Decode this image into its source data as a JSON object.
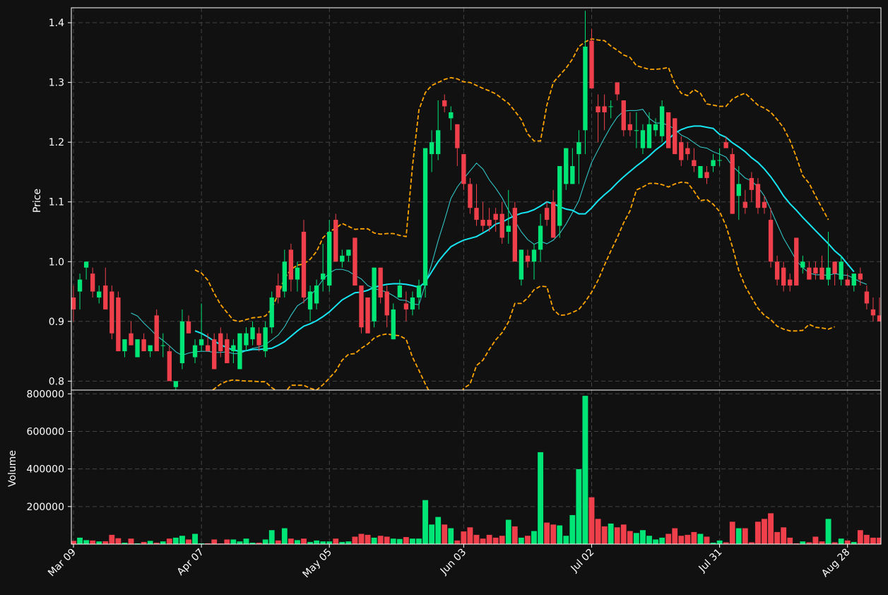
{
  "chart_data": {
    "type": "candlestick",
    "colors": {
      "background": "#111111",
      "up": "#00e676",
      "down": "#ef3f4b",
      "ma_short": "#34d3d3",
      "ma_long": "#17e6f2",
      "bollinger": "#ffa500",
      "grid": "#444444",
      "axes": "#ffffff"
    },
    "price_panel": {
      "ylabel": "Price",
      "ylim": [
        0.785,
        1.425
      ],
      "yticks": [
        0.8,
        0.9,
        1.0,
        1.1,
        1.2,
        1.3,
        1.4
      ],
      "ytick_labels": [
        "0.8",
        "0.9",
        "1.0",
        "1.1",
        "1.2",
        "1.3",
        "1.4"
      ],
      "grid": true
    },
    "volume_panel": {
      "ylabel": "Volume",
      "ylim": [
        0,
        820000
      ],
      "yticks": [
        200000,
        400000,
        600000,
        800000
      ],
      "ytick_labels": [
        "200000",
        "400000",
        "600000",
        "800000"
      ],
      "grid": true
    },
    "x_ticks": [
      {
        "label": "Mar 09",
        "index": 0
      },
      {
        "label": "Apr 07",
        "index": 20
      },
      {
        "label": "May 05",
        "index": 40
      },
      {
        "label": "Jun 03",
        "index": 61
      },
      {
        "label": "Jul 02",
        "index": 81
      },
      {
        "label": "Jul 31",
        "index": 101
      },
      {
        "label": "Aug 28",
        "index": 121
      }
    ],
    "candles": [
      [
        0.94,
        0.96,
        0.9,
        0.92,
        18000
      ],
      [
        0.95,
        0.98,
        0.92,
        0.97,
        35000
      ],
      [
        0.99,
        1.0,
        0.97,
        1.0,
        22000
      ],
      [
        0.98,
        0.99,
        0.94,
        0.95,
        20000
      ],
      [
        0.94,
        0.96,
        0.93,
        0.95,
        15000
      ],
      [
        0.96,
        0.99,
        0.92,
        0.92,
        16000
      ],
      [
        0.95,
        0.96,
        0.87,
        0.88,
        50000
      ],
      [
        0.94,
        0.95,
        0.85,
        0.85,
        32000
      ],
      [
        0.85,
        0.87,
        0.84,
        0.87,
        8000
      ],
      [
        0.88,
        0.9,
        0.86,
        0.86,
        30000
      ],
      [
        0.84,
        0.87,
        0.84,
        0.87,
        5000
      ],
      [
        0.87,
        0.88,
        0.85,
        0.85,
        12000
      ],
      [
        0.85,
        0.86,
        0.84,
        0.86,
        18000
      ],
      [
        0.91,
        0.92,
        0.85,
        0.85,
        8000
      ],
      [
        0.86,
        0.88,
        0.84,
        0.86,
        15000
      ],
      [
        0.85,
        0.86,
        0.8,
        0.8,
        30000
      ],
      [
        0.79,
        0.8,
        0.78,
        0.8,
        35000
      ],
      [
        0.83,
        0.92,
        0.82,
        0.9,
        45000
      ],
      [
        0.9,
        0.91,
        0.88,
        0.88,
        25000
      ],
      [
        0.84,
        0.87,
        0.83,
        0.86,
        55000
      ],
      [
        0.86,
        0.93,
        0.85,
        0.87,
        5000
      ],
      [
        0.86,
        0.88,
        0.85,
        0.85,
        5000
      ],
      [
        0.87,
        0.88,
        0.82,
        0.82,
        25000
      ],
      [
        0.88,
        0.89,
        0.84,
        0.85,
        4000
      ],
      [
        0.87,
        0.88,
        0.83,
        0.83,
        25000
      ],
      [
        0.85,
        0.87,
        0.83,
        0.86,
        25000
      ],
      [
        0.82,
        0.87,
        0.82,
        0.88,
        15000
      ],
      [
        0.86,
        0.89,
        0.85,
        0.88,
        30000
      ],
      [
        0.87,
        0.9,
        0.86,
        0.89,
        8000
      ],
      [
        0.88,
        0.89,
        0.85,
        0.86,
        8000
      ],
      [
        0.85,
        0.9,
        0.84,
        0.89,
        25000
      ],
      [
        0.89,
        0.95,
        0.88,
        0.94,
        75000
      ],
      [
        0.96,
        0.98,
        0.93,
        0.94,
        20000
      ],
      [
        0.95,
        1.02,
        0.94,
        1.0,
        85000
      ],
      [
        1.02,
        1.03,
        0.95,
        0.97,
        30000
      ],
      [
        0.97,
        1.0,
        0.95,
        0.99,
        22000
      ],
      [
        1.05,
        1.07,
        0.93,
        0.94,
        30000
      ],
      [
        0.92,
        0.96,
        0.9,
        0.95,
        12000
      ],
      [
        0.93,
        0.97,
        0.92,
        0.96,
        20000
      ],
      [
        0.97,
        1.03,
        0.95,
        0.98,
        15000
      ],
      [
        0.96,
        1.07,
        0.95,
        1.05,
        15000
      ],
      [
        1.07,
        1.08,
        1.0,
        1.0,
        30000
      ],
      [
        1.0,
        1.02,
        0.99,
        1.01,
        12000
      ],
      [
        1.01,
        1.02,
        1.0,
        1.02,
        15000
      ],
      [
        1.04,
        1.04,
        0.96,
        0.96,
        40000
      ],
      [
        0.96,
        0.96,
        0.88,
        0.89,
        55000
      ],
      [
        0.94,
        0.94,
        0.88,
        0.88,
        50000
      ],
      [
        0.9,
        0.99,
        0.89,
        0.99,
        35000
      ],
      [
        0.99,
        0.99,
        0.93,
        0.94,
        45000
      ],
      [
        0.95,
        0.96,
        0.89,
        0.91,
        40000
      ],
      [
        0.87,
        0.93,
        0.87,
        0.92,
        30000
      ],
      [
        0.94,
        0.97,
        0.94,
        0.96,
        28000
      ],
      [
        0.93,
        0.95,
        0.9,
        0.92,
        38000
      ],
      [
        0.92,
        0.95,
        0.91,
        0.94,
        30000
      ],
      [
        0.94,
        0.97,
        0.92,
        0.96,
        30000
      ],
      [
        0.96,
        1.19,
        0.94,
        1.19,
        235000
      ],
      [
        1.18,
        1.22,
        1.15,
        1.2,
        105000
      ],
      [
        1.18,
        1.27,
        1.17,
        1.22,
        145000
      ],
      [
        1.27,
        1.28,
        1.25,
        1.26,
        105000
      ],
      [
        1.24,
        1.26,
        1.22,
        1.25,
        85000
      ],
      [
        1.23,
        1.23,
        1.16,
        1.19,
        20000
      ],
      [
        1.18,
        1.18,
        1.12,
        1.13,
        68000
      ],
      [
        1.13,
        1.14,
        1.08,
        1.09,
        90000
      ],
      [
        1.09,
        1.13,
        1.06,
        1.07,
        50000
      ],
      [
        1.07,
        1.1,
        1.05,
        1.06,
        30000
      ],
      [
        1.07,
        1.09,
        1.05,
        1.06,
        50000
      ],
      [
        1.08,
        1.09,
        1.05,
        1.07,
        35000
      ],
      [
        1.08,
        1.1,
        1.03,
        1.04,
        45000
      ],
      [
        1.05,
        1.12,
        1.03,
        1.06,
        130000
      ],
      [
        1.09,
        1.1,
        1.0,
        1.0,
        95000
      ],
      [
        0.97,
        1.02,
        0.96,
        1.02,
        35000
      ],
      [
        1.01,
        1.02,
        0.99,
        1.0,
        45000
      ],
      [
        1.0,
        1.03,
        0.97,
        1.02,
        70000
      ],
      [
        1.02,
        1.08,
        1.0,
        1.06,
        490000
      ],
      [
        1.09,
        1.1,
        1.06,
        1.07,
        115000
      ],
      [
        1.1,
        1.12,
        1.05,
        1.04,
        105000
      ],
      [
        1.06,
        1.16,
        1.04,
        1.16,
        100000
      ],
      [
        1.13,
        1.19,
        1.12,
        1.19,
        45000
      ],
      [
        1.13,
        1.19,
        1.13,
        1.16,
        155000
      ],
      [
        1.18,
        1.22,
        1.13,
        1.2,
        400000
      ],
      [
        1.22,
        1.42,
        1.18,
        1.36,
        790000
      ],
      [
        1.37,
        1.39,
        1.29,
        1.29,
        250000
      ],
      [
        1.26,
        1.28,
        1.2,
        1.25,
        135000
      ],
      [
        1.26,
        1.28,
        1.22,
        1.25,
        95000
      ],
      [
        1.26,
        1.27,
        1.24,
        1.26,
        110000
      ],
      [
        1.3,
        1.3,
        1.27,
        1.28,
        90000
      ],
      [
        1.27,
        1.27,
        1.21,
        1.22,
        105000
      ],
      [
        1.23,
        1.25,
        1.21,
        1.22,
        70000
      ],
      [
        1.22,
        1.25,
        1.19,
        1.22,
        60000
      ],
      [
        1.19,
        1.23,
        1.18,
        1.22,
        75000
      ],
      [
        1.19,
        1.25,
        1.19,
        1.23,
        45000
      ],
      [
        1.22,
        1.24,
        1.21,
        1.23,
        25000
      ],
      [
        1.21,
        1.27,
        1.2,
        1.26,
        35000
      ],
      [
        1.25,
        1.25,
        1.19,
        1.19,
        55000
      ],
      [
        1.24,
        1.24,
        1.18,
        1.18,
        85000
      ],
      [
        1.2,
        1.21,
        1.16,
        1.17,
        45000
      ],
      [
        1.19,
        1.2,
        1.17,
        1.18,
        50000
      ],
      [
        1.17,
        1.19,
        1.15,
        1.16,
        65000
      ],
      [
        1.14,
        1.16,
        1.14,
        1.16,
        55000
      ],
      [
        1.15,
        1.16,
        1.13,
        1.14,
        40000
      ],
      [
        1.16,
        1.18,
        1.15,
        1.17,
        8000
      ],
      [
        1.17,
        1.19,
        1.16,
        1.17,
        20000
      ],
      [
        1.2,
        1.21,
        1.19,
        1.19,
        10000
      ],
      [
        1.18,
        1.19,
        1.08,
        1.08,
        120000
      ],
      [
        1.11,
        1.16,
        1.07,
        1.13,
        85000
      ],
      [
        1.1,
        1.12,
        1.08,
        1.09,
        85000
      ],
      [
        1.14,
        1.15,
        1.1,
        1.12,
        10000
      ],
      [
        1.13,
        1.14,
        1.08,
        1.09,
        120000
      ],
      [
        1.1,
        1.11,
        1.08,
        1.09,
        135000
      ],
      [
        1.07,
        1.09,
        0.99,
        1.0,
        165000
      ],
      [
        1.0,
        1.01,
        0.96,
        0.97,
        65000
      ],
      [
        0.99,
        1.0,
        0.95,
        0.96,
        90000
      ],
      [
        0.97,
        0.98,
        0.95,
        0.96,
        35000
      ],
      [
        1.04,
        1.04,
        0.96,
        0.96,
        5000
      ],
      [
        0.99,
        1.01,
        0.98,
        1.0,
        15000
      ],
      [
        0.99,
        1.0,
        0.97,
        0.97,
        10000
      ],
      [
        0.99,
        1.0,
        0.97,
        0.98,
        40000
      ],
      [
        0.99,
        1.01,
        0.97,
        0.97,
        15000
      ],
      [
        0.97,
        1.05,
        0.96,
        0.99,
        135000
      ],
      [
        1.0,
        1.0,
        0.96,
        0.98,
        10000
      ],
      [
        0.97,
        1.01,
        0.96,
        1.0,
        30000
      ],
      [
        0.97,
        0.98,
        0.96,
        0.96,
        20000
      ],
      [
        0.96,
        0.97,
        0.95,
        0.98,
        12000
      ],
      [
        0.98,
        0.99,
        0.96,
        0.97,
        75000
      ],
      [
        0.95,
        0.96,
        0.92,
        0.93,
        50000
      ],
      [
        0.92,
        0.94,
        0.9,
        0.91,
        35000
      ],
      [
        0.91,
        0.94,
        0.9,
        0.9,
        35000
      ]
    ],
    "ma_short": [
      null,
      null,
      null,
      null,
      null,
      null,
      null,
      null,
      null,
      0.914,
      0.909,
      0.897,
      0.887,
      0.876,
      0.868,
      0.859,
      0.849,
      0.843,
      0.847,
      0.849,
      0.85,
      0.85,
      0.848,
      0.848,
      0.849,
      0.846,
      0.846,
      0.851,
      0.855,
      0.857,
      0.861,
      0.869,
      0.877,
      0.891,
      0.91,
      0.926,
      0.933,
      0.943,
      0.955,
      0.97,
      0.981,
      0.987,
      0.987,
      0.984,
      0.977,
      0.971,
      0.96,
      0.955,
      0.952,
      0.949,
      0.943,
      0.936,
      0.935,
      0.929,
      0.928,
      0.962,
      0.996,
      1.035,
      1.069,
      1.106,
      1.125,
      1.139,
      1.152,
      1.165,
      1.155,
      1.137,
      1.123,
      1.107,
      1.086,
      1.068,
      1.05,
      1.037,
      1.029,
      1.034,
      1.03,
      1.036,
      1.047,
      1.063,
      1.082,
      1.102,
      1.135,
      1.166,
      1.187,
      1.207,
      1.226,
      1.242,
      1.252,
      1.253,
      1.253,
      1.255,
      1.24,
      1.232,
      1.232,
      1.228,
      1.222,
      1.212,
      1.207,
      1.199,
      1.192,
      1.19,
      1.184,
      1.18,
      1.175,
      1.16,
      1.15,
      1.14,
      1.135,
      1.125,
      1.11,
      1.087,
      1.063,
      1.039,
      1.021,
      1.002,
      0.99,
      0.981,
      0.978,
      0.978,
      0.977,
      0.98,
      0.978,
      0.977,
      0.972,
      0.966,
      0.962
    ],
    "ma_long": [
      null,
      null,
      null,
      null,
      null,
      null,
      null,
      null,
      null,
      null,
      null,
      null,
      null,
      null,
      null,
      null,
      null,
      null,
      null,
      0.884,
      0.88,
      0.874,
      0.867,
      0.861,
      0.856,
      0.852,
      0.85,
      0.851,
      0.853,
      0.853,
      0.854,
      0.855,
      0.86,
      0.866,
      0.875,
      0.884,
      0.892,
      0.896,
      0.901,
      0.908,
      0.916,
      0.926,
      0.936,
      0.942,
      0.948,
      0.949,
      0.952,
      0.957,
      0.96,
      0.962,
      0.963,
      0.963,
      0.962,
      0.96,
      0.957,
      0.966,
      0.983,
      1.0,
      1.013,
      1.025,
      1.031,
      1.036,
      1.039,
      1.042,
      1.048,
      1.054,
      1.063,
      1.066,
      1.072,
      1.077,
      1.081,
      1.083,
      1.087,
      1.093,
      1.1,
      1.097,
      1.092,
      1.088,
      1.086,
      1.08,
      1.08,
      1.09,
      1.102,
      1.112,
      1.121,
      1.132,
      1.142,
      1.151,
      1.16,
      1.168,
      1.177,
      1.187,
      1.195,
      1.205,
      1.215,
      1.221,
      1.225,
      1.227,
      1.227,
      1.225,
      1.223,
      1.213,
      1.208,
      1.199,
      1.192,
      1.184,
      1.174,
      1.166,
      1.155,
      1.142,
      1.127,
      1.11,
      1.097,
      1.086,
      1.074,
      1.063,
      1.052,
      1.041,
      1.03,
      1.018,
      1.009,
      0.996,
      0.983
    ],
    "bb_upper": [
      null,
      null,
      null,
      null,
      null,
      null,
      null,
      null,
      null,
      null,
      null,
      null,
      null,
      null,
      null,
      null,
      null,
      null,
      null,
      0.986,
      0.981,
      0.969,
      0.947,
      0.928,
      0.915,
      0.902,
      0.9,
      0.903,
      0.906,
      0.907,
      0.909,
      0.921,
      0.946,
      0.972,
      0.987,
      0.994,
      0.996,
      1.004,
      1.017,
      1.04,
      1.05,
      1.056,
      1.064,
      1.059,
      1.054,
      1.055,
      1.055,
      1.048,
      1.046,
      1.047,
      1.047,
      1.044,
      1.042,
      1.16,
      1.254,
      1.283,
      1.295,
      1.3,
      1.305,
      1.308,
      1.306,
      1.301,
      1.3,
      1.295,
      1.29,
      1.286,
      1.281,
      1.273,
      1.265,
      1.252,
      1.238,
      1.214,
      1.202,
      1.202,
      1.262,
      1.3,
      1.312,
      1.324,
      1.339,
      1.36,
      1.368,
      1.373,
      1.371,
      1.37,
      1.361,
      1.354,
      1.346,
      1.342,
      1.328,
      1.325,
      1.322,
      1.322,
      1.323,
      1.325,
      1.298,
      1.282,
      1.278,
      1.288,
      1.282,
      1.264,
      1.262,
      1.26,
      1.26,
      1.272,
      1.278,
      1.282,
      1.272,
      1.262,
      1.257,
      1.25,
      1.238,
      1.224,
      1.203,
      1.175,
      1.144,
      1.131,
      1.11,
      1.09,
      1.07
    ],
    "bb_lower": [
      null,
      null,
      null,
      null,
      null,
      null,
      null,
      null,
      null,
      null,
      null,
      null,
      null,
      null,
      null,
      null,
      null,
      null,
      null,
      0.782,
      0.78,
      0.779,
      0.787,
      0.795,
      0.8,
      0.802,
      0.801,
      0.8,
      0.8,
      0.799,
      0.799,
      0.789,
      0.782,
      0.78,
      0.793,
      0.793,
      0.793,
      0.788,
      0.785,
      0.794,
      0.805,
      0.817,
      0.835,
      0.845,
      0.846,
      0.855,
      0.862,
      0.872,
      0.877,
      0.879,
      0.877,
      0.876,
      0.87,
      0.84,
      0.818,
      0.795,
      0.775,
      0.765,
      0.76,
      0.76,
      0.766,
      0.788,
      0.795,
      0.826,
      0.835,
      0.853,
      0.869,
      0.881,
      0.899,
      0.93,
      0.93,
      0.939,
      0.953,
      0.959,
      0.958,
      0.92,
      0.91,
      0.911,
      0.915,
      0.92,
      0.933,
      0.949,
      0.969,
      0.994,
      1.018,
      1.04,
      1.065,
      1.085,
      1.12,
      1.125,
      1.131,
      1.131,
      1.129,
      1.125,
      1.13,
      1.133,
      1.132,
      1.118,
      1.102,
      1.104,
      1.096,
      1.084,
      1.06,
      1.025,
      0.985,
      0.959,
      0.94,
      0.922,
      0.91,
      0.903,
      0.892,
      0.887,
      0.884,
      0.884,
      0.885,
      0.895,
      0.89,
      0.889,
      0.887,
      0.891
    ]
  }
}
